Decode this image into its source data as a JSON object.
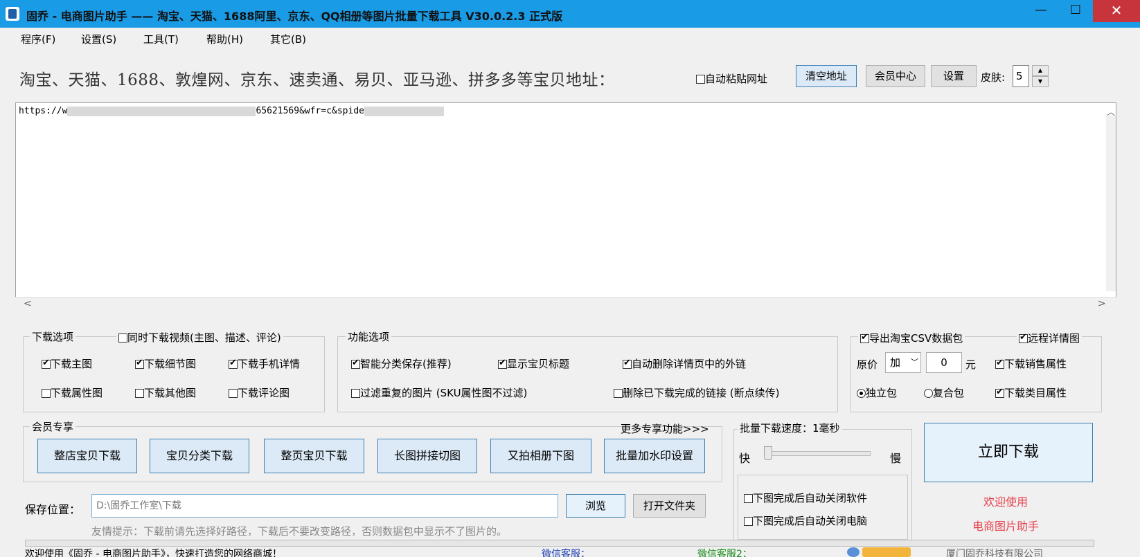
{
  "window": {
    "title": "固乔 - 电商图片助手 —— 淘宝、天猫、1688阿里、京东、QQ相册等图片批量下载工具 V30.0.2.3 正式版",
    "min": "—",
    "max": "☐",
    "close": "✕"
  },
  "menu": [
    "程序(F)",
    "设置(S)",
    "工具(T)",
    "帮助(H)",
    "其它(B)"
  ],
  "url_row": {
    "label": "淘宝、天猫、1688、敦煌网、京东、速卖通、易贝、亚马逊、拼多多等宝贝地址：",
    "auto_paste": "自动粘贴网址",
    "clear": "清空地址",
    "member_center": "会员中心",
    "settings": "设置",
    "skin_label": "皮肤:",
    "skin_value": "5"
  },
  "url_input": {
    "prefix": "https://w",
    "middle": "65621569&wfr=c&spide",
    "scroll_left": "<",
    "scroll_right": ">"
  },
  "download_options": {
    "title": "下载选项",
    "video": "同时下载视频(主图、描述、评论)",
    "main": "下载主图",
    "detail": "下载细节图",
    "mobile": "下载手机详情",
    "attr": "下载属性图",
    "other": "下载其他图",
    "review": "下载评论图"
  },
  "function_options": {
    "title": "功能选项",
    "smart": "智能分类保存(推荐)",
    "show_title": "显示宝贝标题",
    "remove_links": "自动删除详情页中的外链",
    "filter_dup": "过滤重复的图片 (SKU属性图不过滤)",
    "delete_done": "删除已下载完成的链接 (断点续传)"
  },
  "csv_options": {
    "export_csv": "导出淘宝CSV数据包",
    "remote_detail": "远程详情图",
    "price_label": "原价",
    "price_op": "加",
    "price_value": "0",
    "price_unit": "元",
    "sales_attr": "下载销售属性",
    "independent": "独立包",
    "composite": "复合包",
    "category_attr": "下载类目属性"
  },
  "vip": {
    "title": "会员专享",
    "more": "更多专享功能>>>",
    "buttons": [
      "整店宝贝下载",
      "宝贝分类下载",
      "整页宝贝下载",
      "长图拼接切图",
      "又拍相册下图",
      "批量加水印设置"
    ]
  },
  "speed": {
    "title": "批量下载速度：1毫秒",
    "fast": "快",
    "slow": "慢",
    "close_app": "下图完成后自动关闭软件",
    "shutdown": "下图完成后自动关闭电脑"
  },
  "download_now": "立即下载",
  "welcome1": "欢迎使用",
  "welcome2": "电商图片助手",
  "save": {
    "label": "保存位置：",
    "path": "D:\\固乔工作室\\下载",
    "browse": "浏览",
    "open_folder": "打开文件夹",
    "tip": "友情提示：下载前请先选择好路径，下载后不要改变路径，否则数据包中显示不了图片的。"
  },
  "status": {
    "welcome": "欢迎使用《固乔 - 电商图片助手》，快速打造您的网络商城！",
    "wechat1": "微信客服：",
    "wechat2": "微信客服2：",
    "company": "厦门固乔科技有限公司"
  }
}
